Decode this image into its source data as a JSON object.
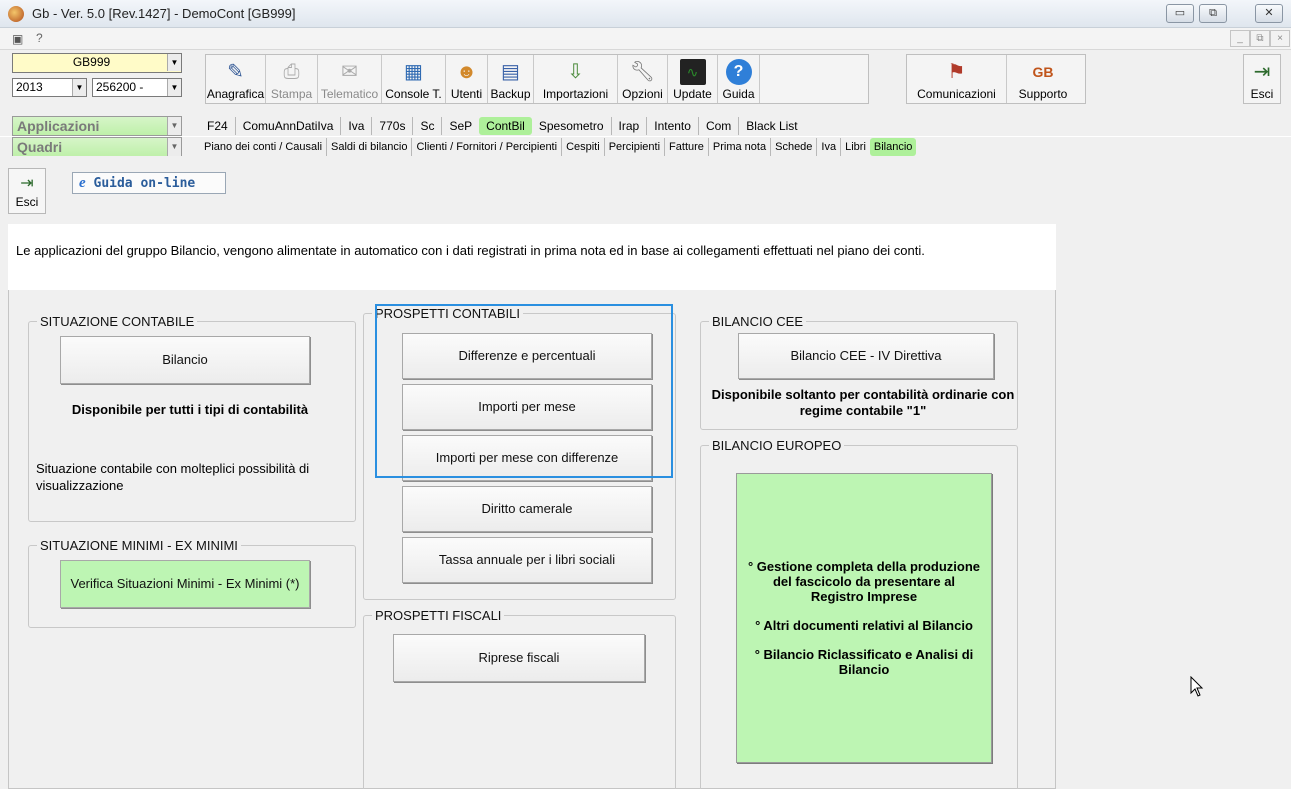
{
  "window": {
    "title": "Gb - Ver. 5.0 [Rev.1427] -  DemoCont [GB999]",
    "controls": [
      "▭",
      "⧉",
      "✕"
    ]
  },
  "menustrip": {
    "help": "?",
    "mdi_controls": [
      "_",
      "⧉",
      "×"
    ]
  },
  "toolbar": {
    "company_code": "GB999",
    "year": "2013",
    "account": "256200 -",
    "buttons_left": [
      {
        "label": "Anagrafica",
        "icon": "address-card-icon",
        "disabled": false
      },
      {
        "label": "Stampa",
        "icon": "printer-icon",
        "disabled": true
      },
      {
        "label": "Telematico",
        "icon": "telematic-icon",
        "disabled": true
      },
      {
        "label": "Console T.",
        "icon": "console-icon",
        "disabled": false
      },
      {
        "label": "Utenti",
        "icon": "users-icon",
        "disabled": false
      },
      {
        "label": "Backup",
        "icon": "backup-icon",
        "disabled": false
      },
      {
        "label": "Importazioni",
        "icon": "import-icon",
        "disabled": false
      },
      {
        "label": "Opzioni",
        "icon": "wrench-icon",
        "disabled": false
      },
      {
        "label": "Update",
        "icon": "update-icon",
        "disabled": false
      },
      {
        "label": "Guida",
        "icon": "help-icon",
        "disabled": false
      }
    ],
    "comunicazioni": "Comunicazioni",
    "supporto": "Supporto",
    "esci": "Esci"
  },
  "nav": {
    "applicazioni_label": "Applicazioni",
    "applicazioni_items": [
      "F24",
      "ComuAnnDatiIva",
      "Iva",
      "770s",
      "Sc",
      "SeP",
      "ContBil",
      "Spesometro",
      "Irap",
      "Intento",
      "Com",
      "Black List"
    ],
    "applicazioni_active": "ContBil",
    "quadri_label": "Quadri",
    "quadri_items": [
      "Piano dei conti / Causali",
      "Saldi di bilancio",
      "Clienti / Fornitori / Percipienti",
      "Cespiti",
      "Percipienti",
      "Fatture",
      "Prima nota",
      "Schede",
      "Iva",
      "Libri",
      "Bilancio"
    ],
    "quadri_active": "Bilancio"
  },
  "content": {
    "esci": "Esci",
    "guida_online": "Guida on-line",
    "intro": "Le applicazioni del gruppo Bilancio, vengono alimentate in automatico con i dati registrati in prima nota ed in base ai collegamenti effettuati nel piano dei conti.",
    "situazione_contabile": {
      "legend": "SITUAZIONE CONTABILE",
      "button": "Bilancio",
      "note": "Disponibile per tutti i tipi di contabilità",
      "desc": "Situazione contabile con molteplici possibilità di visualizzazione"
    },
    "situazione_minimi": {
      "legend": "SITUAZIONE MINIMI - EX MINIMI",
      "button": "Verifica Situazioni Minimi - Ex Minimi (*)"
    },
    "prospetti_contabili": {
      "legend": "PROSPETTI CONTABILI",
      "buttons": [
        "Differenze e percentuali",
        "Importi per mese",
        "Importi per mese con differenze",
        "Diritto camerale",
        "Tassa annuale per i libri sociali"
      ]
    },
    "prospetti_fiscali": {
      "legend": "PROSPETTI FISCALI",
      "button": "Riprese fiscali"
    },
    "bilancio_cee": {
      "legend": "BILANCIO CEE",
      "button": "Bilancio CEE - IV Direttiva",
      "note": "Disponibile soltanto per contabilità ordinarie con regime contabile \"1\""
    },
    "bilancio_europeo": {
      "legend": "BILANCIO EUROPEO",
      "items": [
        "° Gestione completa della produzione del fascicolo da presentare al Registro Imprese",
        "° Altri documenti relativi al Bilancio",
        "° Bilancio Riclassificato e Analisi di Bilancio"
      ]
    }
  },
  "colors": {
    "active_tab": "#aef09a",
    "green_button": "#bdf5b3",
    "highlight_border": "#2a8fe0"
  }
}
